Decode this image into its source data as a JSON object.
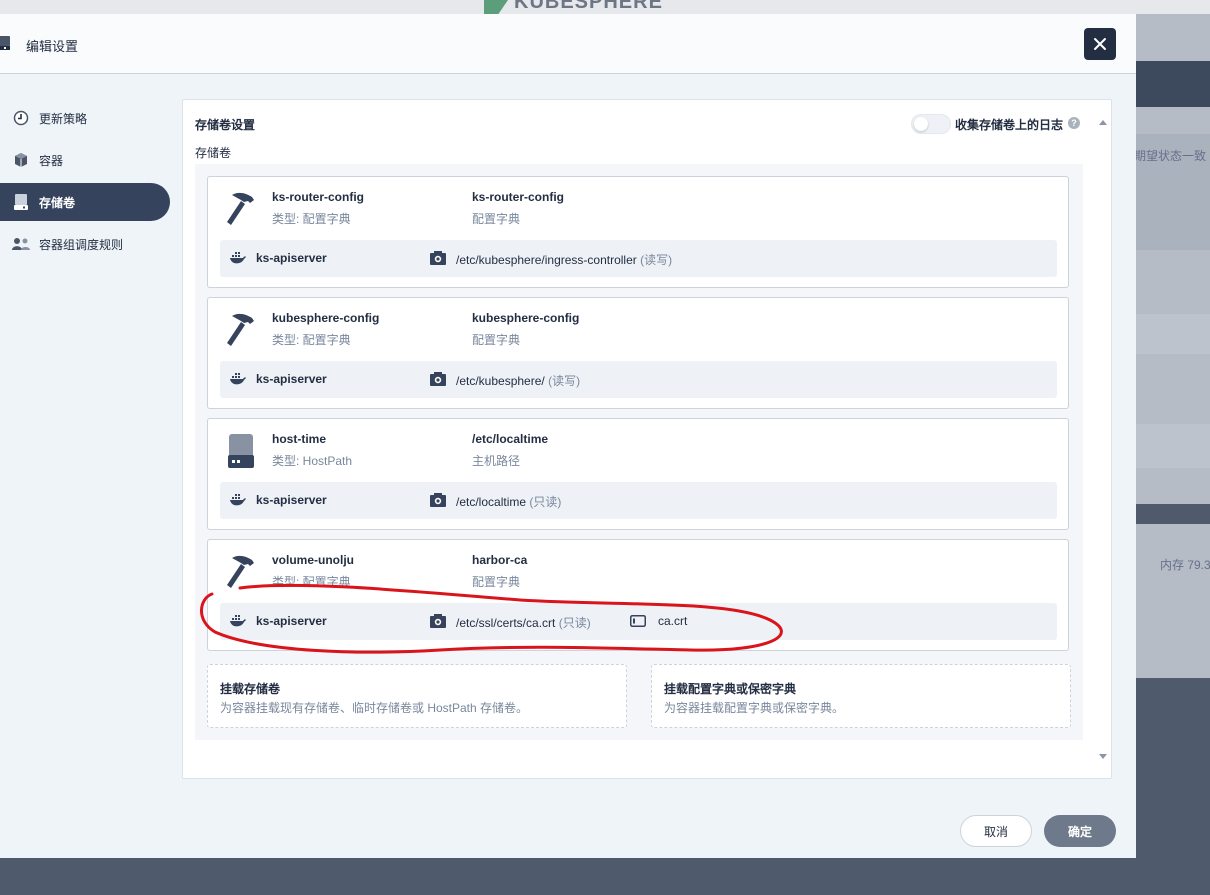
{
  "background": {
    "logo_text": "KUBESPHERE",
    "right_text_1": "期望状态一致",
    "right_text_2": "内存 79.3"
  },
  "modal": {
    "title": "编辑设置",
    "close_icon": "close-icon"
  },
  "sidebar": {
    "items": [
      {
        "label": "更新策略",
        "icon": "update-strategy-icon",
        "active": false
      },
      {
        "label": "容器",
        "icon": "container-icon",
        "active": false
      },
      {
        "label": "存储卷",
        "icon": "volume-icon",
        "active": true
      },
      {
        "label": "容器组调度规则",
        "icon": "scheduling-icon",
        "active": false
      }
    ]
  },
  "storage": {
    "section_title": "存储卷设置",
    "subtitle": "存储卷",
    "toggle_label": "收集存储卷上的日志",
    "toggle_on": false,
    "help_icon": "?"
  },
  "volumes": [
    {
      "name": "ks-router-config",
      "type": "类型: 配置字典",
      "source": "ks-router-config",
      "source_type": "配置字典",
      "icon": "hammer-icon",
      "mount": {
        "container": "ks-apiserver",
        "path": "/etc/kubesphere/ingress-controller",
        "mode": "(读写)",
        "key": ""
      }
    },
    {
      "name": "kubesphere-config",
      "type": "类型: 配置字典",
      "source": "kubesphere-config",
      "source_type": "配置字典",
      "icon": "hammer-icon",
      "mount": {
        "container": "ks-apiserver",
        "path": "/etc/kubesphere/",
        "mode": "(读写)",
        "key": ""
      }
    },
    {
      "name": "host-time",
      "type": "类型: HostPath",
      "source": "/etc/localtime",
      "source_type": "主机路径",
      "icon": "disk-icon",
      "mount": {
        "container": "ks-apiserver",
        "path": "/etc/localtime",
        "mode": "(只读)",
        "key": ""
      }
    },
    {
      "name": "volume-unolju",
      "type": "类型: 配置字典",
      "source": "harbor-ca",
      "source_type": "配置字典",
      "icon": "hammer-icon",
      "mount": {
        "container": "ks-apiserver",
        "path": "/etc/ssl/certs/ca.crt",
        "mode": "(只读)",
        "key": "ca.crt"
      }
    }
  ],
  "add_actions": {
    "mount_volume": {
      "title": "挂载存储卷",
      "desc": "为容器挂载现有存储卷、临时存储卷或 HostPath 存储卷。"
    },
    "mount_config": {
      "title": "挂载配置字典或保密字典",
      "desc": "为容器挂载配置字典或保密字典。"
    }
  },
  "footer": {
    "cancel_label": "取消",
    "ok_label": "确定"
  },
  "colors": {
    "annotation": "#d9141b",
    "active_nav": "#36435c",
    "ok_button": "#6e7a8c"
  }
}
